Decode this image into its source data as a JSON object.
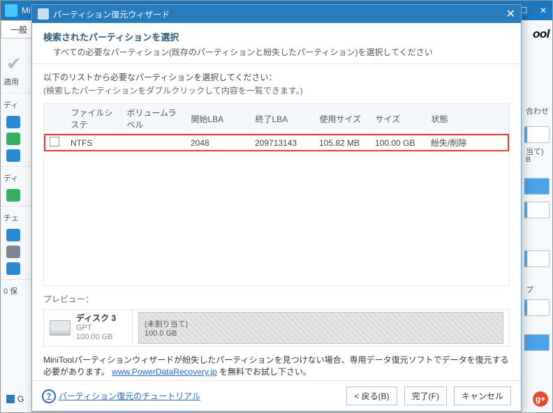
{
  "bg": {
    "title": "Mi",
    "tab": "一般",
    "apply_label": "適用",
    "section_disk": "ディ",
    "section_check": "チェ",
    "section_protect": "0 保",
    "legend": "G",
    "right_ool": "ool",
    "right_txt1": "当て)",
    "right_txt2": "B",
    "right_txt3": "プ",
    "right_txt4": "合わせ"
  },
  "wizard": {
    "title": "パーティション復元ウィザード",
    "header_title": "検索されたパーティションを選択",
    "header_sub": "すべての必要なパーティション(既存のパーティションと紛失したパーティション)を選択してください",
    "hint1": "以下のリストから必要なパーティションを選択してください：",
    "hint2": "(検索したパーティションをダブルクリックして内容を一覧できます。)",
    "columns": {
      "fs": "ファイルシステ",
      "label": "ボリュームラベル",
      "start": "開始LBA",
      "end": "終了LBA",
      "used": "使用サイズ",
      "size": "サイズ",
      "state": "状態"
    },
    "rows": [
      {
        "fs": "NTFS",
        "label": "",
        "start": "2048",
        "end": "209713143",
        "used": "105.82 MB",
        "size": "100.00 GB",
        "state": "紛失/削除"
      }
    ],
    "preview_label": "プレビュー：",
    "preview": {
      "disk_name": "ディスク 3",
      "disk_type": "GPT",
      "disk_size": "100.00 GB",
      "seg_line1": "(未割り当て)",
      "seg_line2": "100.0 GB"
    },
    "notice_prefix": "MiniToolパーティションウィザードが紛失したパーティションを見つけない場合、専用データ復元ソフトでデータを復元する必要があります。",
    "notice_link": "www.PowerDataRecovery.jp",
    "notice_suffix": "を無料でお試し下さい。",
    "help_link": "パーティション復元のチュートリアル",
    "btn_back": "< 戻る(B)",
    "btn_finish": "完了(F)",
    "btn_cancel": "キャンセル"
  }
}
